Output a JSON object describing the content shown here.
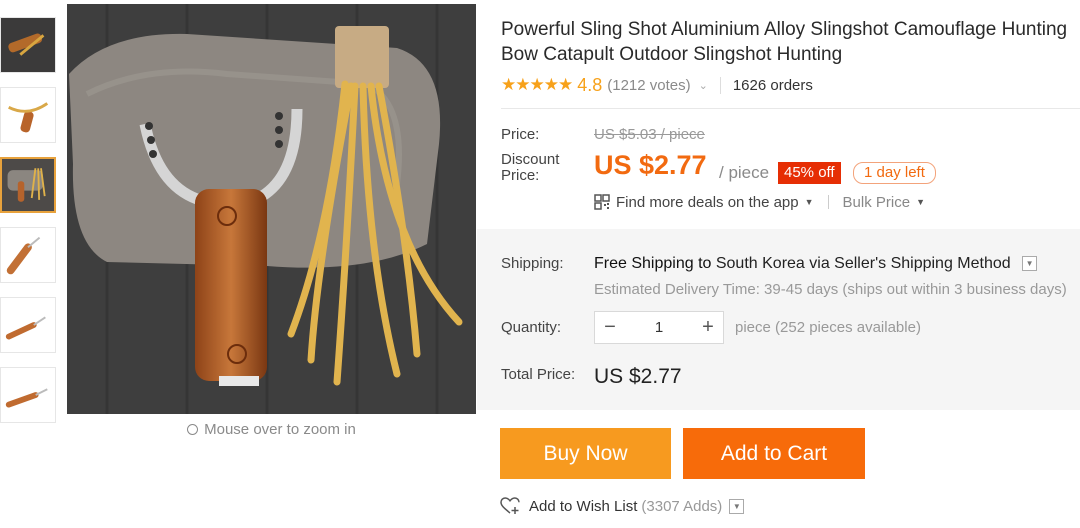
{
  "product": {
    "title_line1": "Powerful Sling Shot Aluminium Alloy Slingshot Camouflage Hunting",
    "title_line2": "Bow Catapult Outdoor Slingshot Hunting"
  },
  "rating": {
    "stars": "★★★★★",
    "value": "4.8",
    "votes": "(1212 votes)",
    "orders": "1626 orders"
  },
  "price": {
    "label": "Price:",
    "original": "US $5.03 / piece",
    "discount_label": "Discount Price:",
    "sale": "US $2.77",
    "per_piece": "/ piece",
    "off_badge": "45% off",
    "days_left": "1 day left",
    "deals_text": "Find more deals on the app",
    "bulk_price": "Bulk Price"
  },
  "shipping": {
    "label": "Shipping:",
    "free": "Free Shipping to",
    "destination": "South Korea via Seller's Shipping Method",
    "estimate": "Estimated Delivery Time: 39-45 days (ships out within 3 business days)"
  },
  "quantity": {
    "label": "Quantity:",
    "value": "1",
    "minus": "−",
    "plus": "+",
    "available": "piece (252 pieces available)"
  },
  "total": {
    "label": "Total Price:",
    "value": "US $2.77"
  },
  "actions": {
    "buy_now": "Buy Now",
    "add_to_cart": "Add to Cart",
    "wish_list": "Add to Wish List",
    "wish_adds": "(3307 Adds)"
  },
  "gallery": {
    "zoom_hint": "Mouse over to zoom in",
    "thumbnail_count": 6,
    "active_thumbnail": 3
  },
  "colors": {
    "accent_orange": "#f26a10",
    "buy_now": "#f79a1f",
    "add_to_cart": "#f76b0a",
    "discount_badge": "#e62e04",
    "star": "#f7a11a"
  }
}
